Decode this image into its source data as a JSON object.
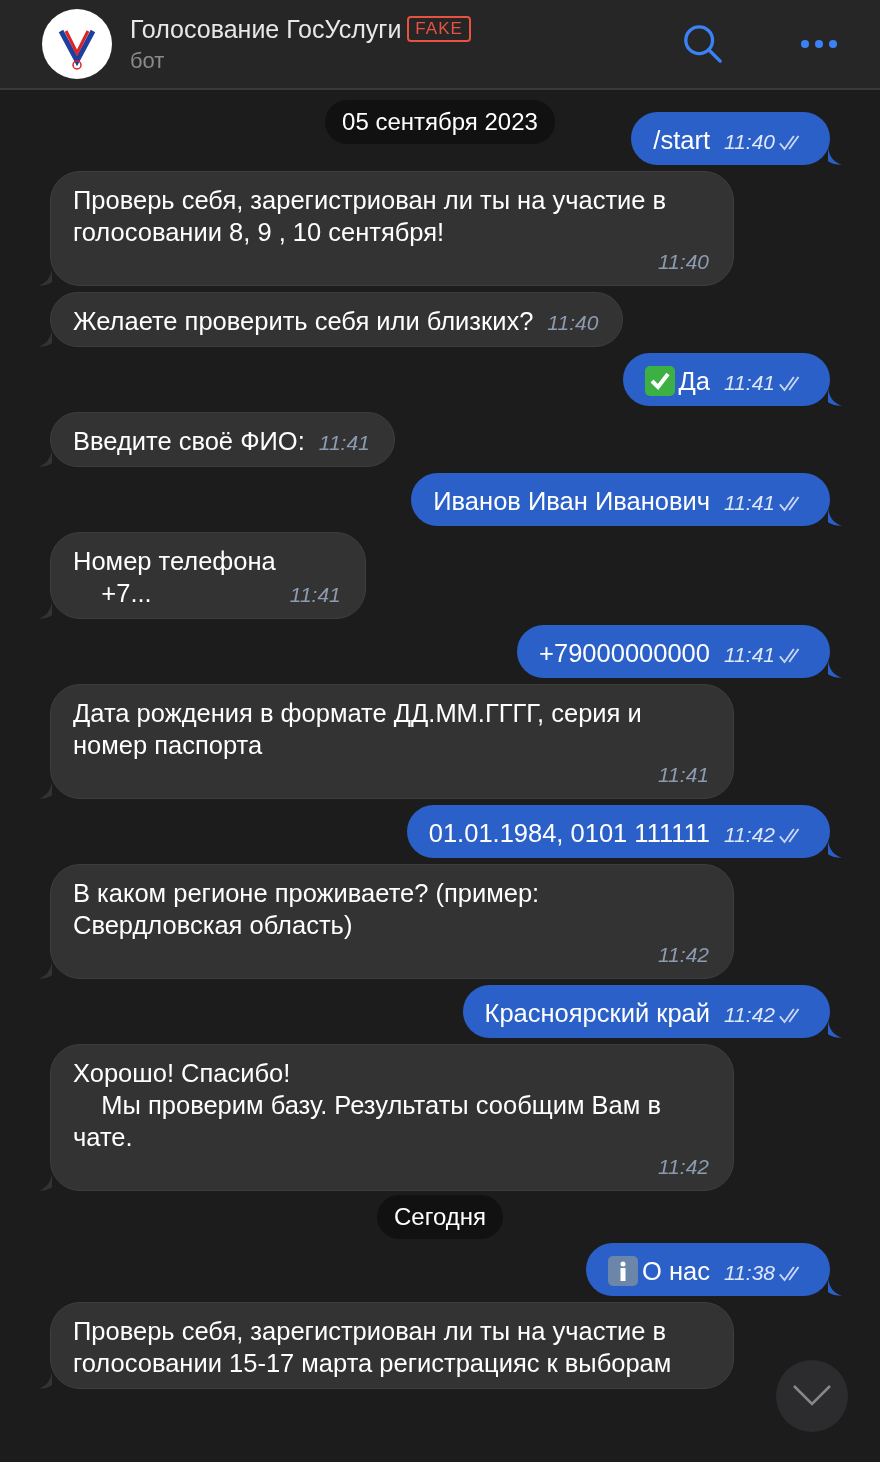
{
  "header": {
    "title": "Голосование ГосУслуги",
    "badge": "FAKE",
    "subtitle": "бот"
  },
  "sticky_date": "05 сентября 2023",
  "messages": [
    {
      "kind": "out",
      "text": "/start",
      "time": "11:40",
      "read": true
    },
    {
      "kind": "in",
      "text": "Проверь себя, зарегистриован ли ты на участие в голосовании 8, 9 , 10 сентября!",
      "time": "11:40"
    },
    {
      "kind": "in",
      "text": "Желаете проверить себя или близких?",
      "time": "11:40"
    },
    {
      "kind": "confirm",
      "text": "Да",
      "time": "11:41",
      "read": true
    },
    {
      "kind": "in",
      "text": "Введите своё ФИО:",
      "time": "11:41"
    },
    {
      "kind": "out",
      "text": "Иванов Иван Иванович",
      "time": "11:41",
      "read": true
    },
    {
      "kind": "in",
      "text": "Номер телефона\n    +7...",
      "time": "11:41"
    },
    {
      "kind": "out",
      "text": "+79000000000",
      "time": "11:41",
      "read": true
    },
    {
      "kind": "in",
      "text": "Дата рождения в формате ДД.ММ.ГГГГ, серия и номер паспорта",
      "time": "11:41"
    },
    {
      "kind": "out",
      "text": "01.01.1984, 0101 111111",
      "time": "11:42",
      "read": true
    },
    {
      "kind": "in",
      "text": "В каком регионе проживаете? (пример: Свердловская область)",
      "time": "11:42"
    },
    {
      "kind": "out",
      "text": "Красноярский край",
      "time": "11:42",
      "read": true
    },
    {
      "kind": "in",
      "text": "Хорошо! Спасибо!\n    Мы проверим базу. Результаты сообщим Вам в чате.",
      "time": "11:42"
    },
    {
      "kind": "date",
      "text": "Сегодня"
    },
    {
      "kind": "about",
      "text": "О нас",
      "time": "11:38",
      "read": true
    },
    {
      "kind": "in",
      "text": "Проверь себя, зарегистриован ли ты на участие в голосовании 15-17 марта регистрацияс к выборам"
    }
  ]
}
